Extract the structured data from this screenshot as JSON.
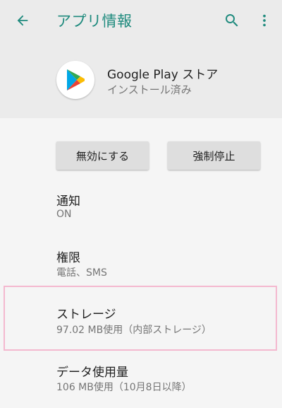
{
  "toolbar": {
    "title": "アプリ情報",
    "accent_color": "#1e8a7d",
    "back_icon": "arrow-left-icon",
    "search_icon": "search-icon",
    "more_icon": "more-vertical-icon"
  },
  "app": {
    "name": "Google Play ストア",
    "status": "インストール済み",
    "icon": "google-play-icon"
  },
  "buttons": {
    "disable": "無効にする",
    "force_stop": "強制停止"
  },
  "items": [
    {
      "title": "通知",
      "subtitle": "ON"
    },
    {
      "title": "権限",
      "subtitle": "電話、SMS"
    },
    {
      "title": "ストレージ",
      "subtitle": "97.02 MB使用（内部ストレージ）"
    },
    {
      "title": "データ使用量",
      "subtitle": "106 MB使用（10月8日以降）"
    }
  ]
}
